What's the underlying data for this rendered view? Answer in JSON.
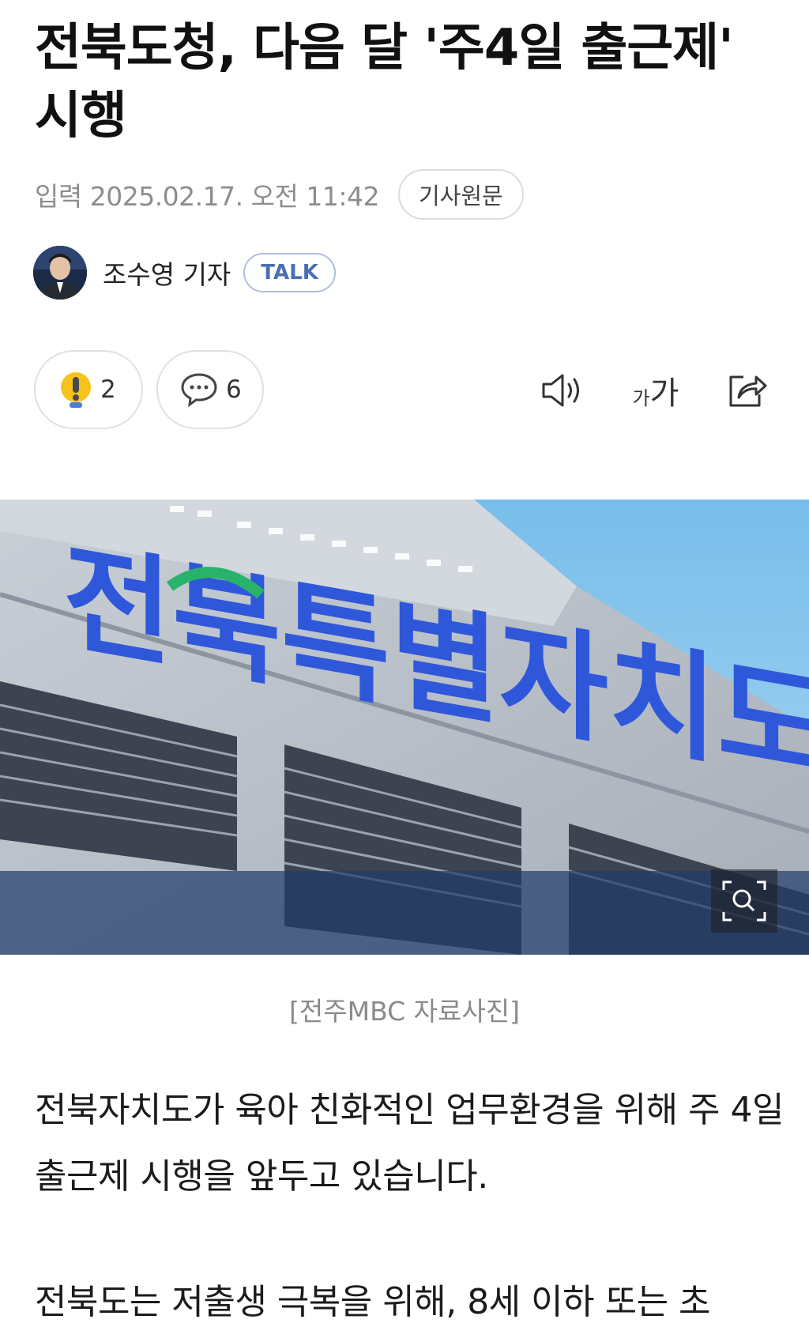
{
  "article": {
    "title": "전북도청, 다음 달 '주4일 출근제' 시행",
    "date": "입력 2025.02.17. 오전 11:42",
    "original_button": "기사원문",
    "author": {
      "name": "조수영 기자",
      "badge": "TALK"
    },
    "actions": {
      "reaction_count": "2",
      "comment_count": "6"
    },
    "tools": {
      "font_size_label_small": "가",
      "font_size_label_large": "가"
    },
    "photo": {
      "sign_text": "전북특별자치도",
      "caption": "[전주MBC 자료사진]"
    },
    "paragraphs": [
      "전북자치도가 육아 친화적인 업무환경을 위해 주 4일 출근제 시행을 앞두고 있습니다.",
      "전북도는 저출생 극복을 위해, 8세 이하 또는 초"
    ]
  },
  "colors": {
    "accent_blue": "#4a6fb5",
    "sign_blue": "#2f57d9",
    "sky": "#7fc1ec",
    "reaction_yellow": "#f6c31b"
  }
}
